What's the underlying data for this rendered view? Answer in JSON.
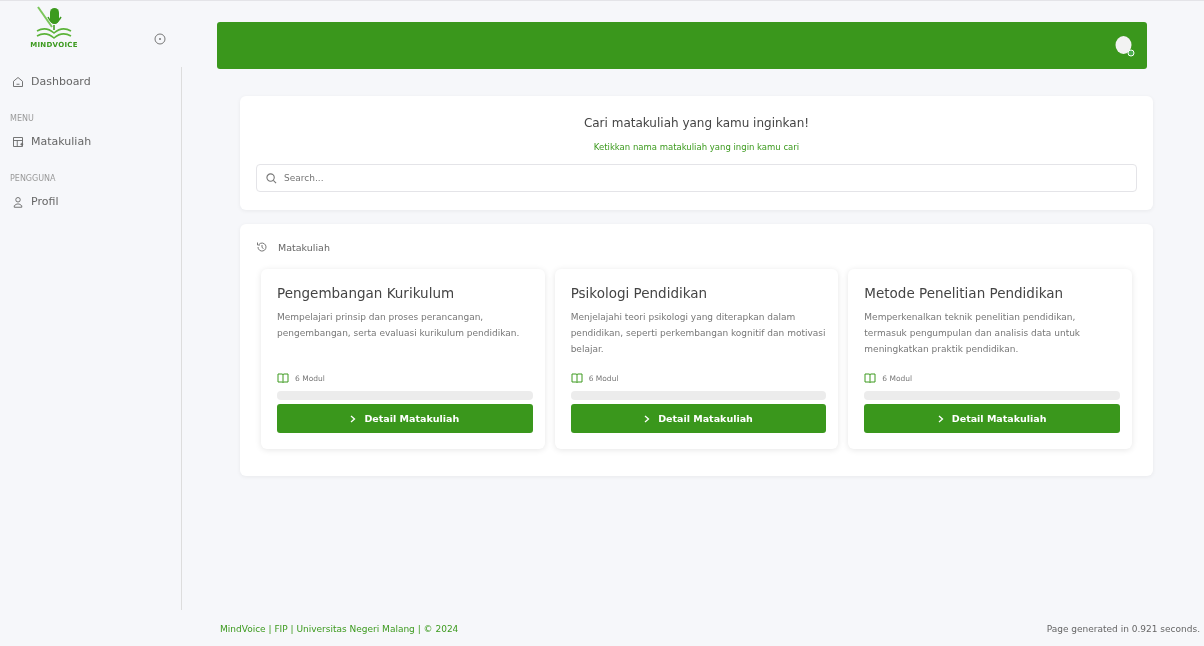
{
  "sidebar": {
    "logo_text": "MINDVOICE",
    "items": [
      {
        "kind": "link",
        "label": "Dashboard"
      },
      {
        "kind": "heading",
        "label": "MENU"
      },
      {
        "kind": "link",
        "label": "Matakuliah"
      },
      {
        "kind": "heading",
        "label": "PENGGUNA"
      },
      {
        "kind": "link",
        "label": "Profil"
      }
    ]
  },
  "search": {
    "title": "Cari matakuliah yang kamu inginkan!",
    "subtitle": "Ketikkan nama matakuliah yang ingin kamu cari",
    "placeholder": "Search..."
  },
  "courses": {
    "heading": "Matakuliah",
    "cards": [
      {
        "title": "Pengembangan Kurikulum",
        "description": "Mempelajari prinsip dan proses perancangan, pengembangan, serta evaluasi kurikulum pendidikan.",
        "modules": "6 Modul",
        "level": 0,
        "button": "Detail Matakuliah"
      },
      {
        "title": "Psikologi Pendidikan",
        "description": "Menjelajahi teori psikologi yang diterapkan dalam pendidikan, seperti perkembangan kognitif dan motivasi belajar.",
        "modules": "6 Modul",
        "level": 0,
        "button": "Detail Matakuliah"
      },
      {
        "title": "Metode Penelitian Pendidikan",
        "description": "Memperkenalkan teknik penelitian pendidikan, termasuk pengumpulan dan analisis data untuk meningkatkan praktik pendidikan.",
        "modules": "6 Modul",
        "level": 0,
        "button": "Detail Matakuliah"
      }
    ]
  },
  "footer": {
    "credits": "MindVoice | FIP | Universitas Negeri Malang | © 2024",
    "timing": "Page generated in 0.921 seconds."
  }
}
